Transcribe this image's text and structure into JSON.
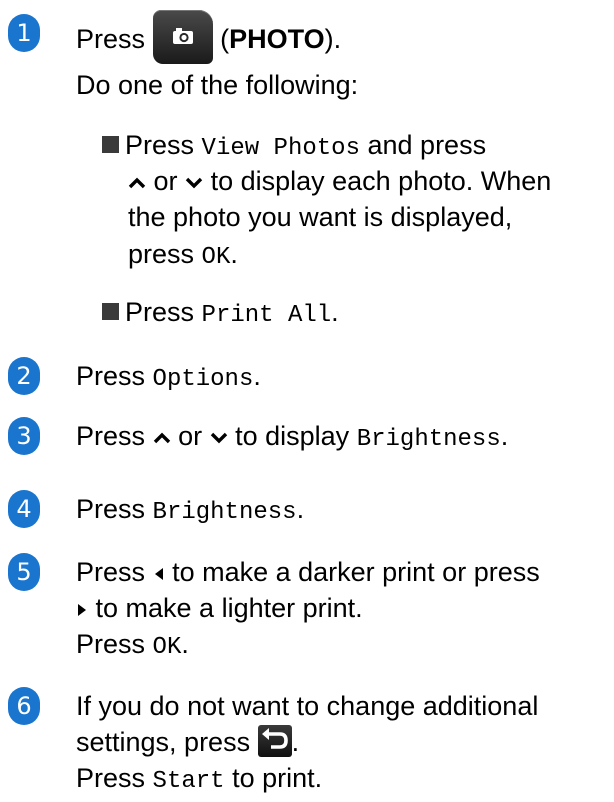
{
  "steps": [
    {
      "number": "1"
    },
    {
      "number": "2"
    },
    {
      "number": "3"
    },
    {
      "number": "4"
    },
    {
      "number": "5"
    },
    {
      "number": "6"
    }
  ],
  "s1": {
    "press": "Press",
    "photo_open": "(",
    "photo_label": "PHOTO",
    "photo_close": ").",
    "do_one": "Do one of the following:",
    "b1_press": "Press",
    "b1_view": "View Photos",
    "b1_and_press": "and press",
    "b1_or": "or",
    "b1_display": "to display each photo. When",
    "b1_line3": "the photo you want is displayed,",
    "b1_press2": "press",
    "b1_ok": "OK",
    "period": ".",
    "b2_press": "Press",
    "b2_print_all": "Print All",
    "b2_period": "."
  },
  "s2": {
    "press": "Press",
    "options": "Options",
    "period": "."
  },
  "s3": {
    "press": "Press",
    "or": "or",
    "to_display": "to display",
    "brightness": "Brightness",
    "period": "."
  },
  "s4": {
    "press": "Press",
    "brightness": "Brightness",
    "period": "."
  },
  "s5": {
    "press": "Press",
    "darker": "to make a darker print or press",
    "lighter": "to make a lighter print.",
    "press2": "Press",
    "ok": "OK",
    "period": "."
  },
  "s6": {
    "line1": "If you do not want to change additional",
    "settings": "settings, press",
    "period": ".",
    "press": "Press",
    "start": "Start",
    "to_print": "to print."
  },
  "icons": {
    "photo": "photo-button-icon",
    "back": "back-button-icon",
    "up": "up-arrow-icon",
    "down": "down-arrow-icon",
    "left": "left-arrow-icon",
    "right": "right-arrow-icon"
  },
  "colors": {
    "step_bubble": "#1a75ce",
    "bullet": "#3a3a3a"
  }
}
